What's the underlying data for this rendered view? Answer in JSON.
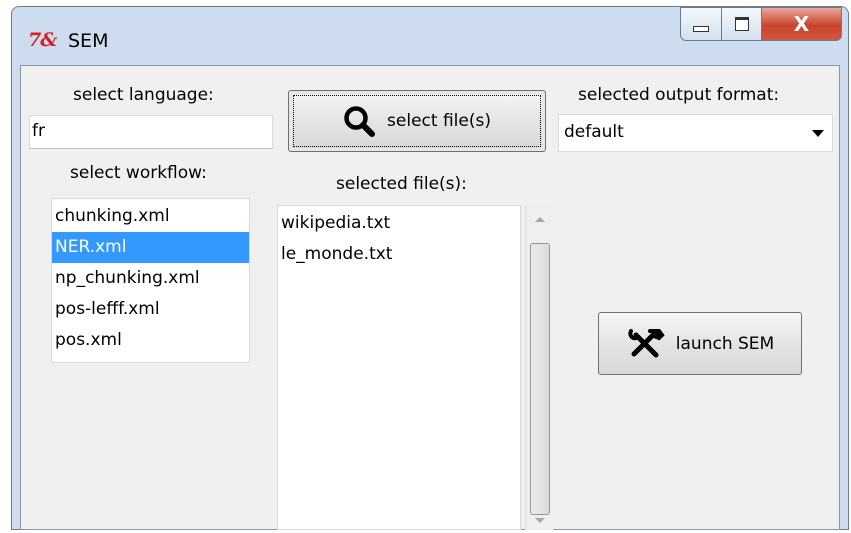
{
  "window": {
    "logo": "7&",
    "title": "SEM",
    "close_glyph": "X"
  },
  "language": {
    "label": "select language:",
    "value": "fr"
  },
  "select_file_button": {
    "icon": "search-icon",
    "label": "select file(s)"
  },
  "output_format": {
    "label": "selected output format:",
    "selected": "default"
  },
  "workflow": {
    "label": "select workflow:",
    "items": [
      "chunking.xml",
      "NER.xml",
      "np_chunking.xml",
      "pos-lefff.xml",
      "pos.xml"
    ],
    "selected_index": 1
  },
  "files": {
    "label": "selected file(s):",
    "items": [
      "wikipedia.txt",
      "le_monde.txt"
    ]
  },
  "launch_button": {
    "icon": "tools-icon",
    "label": "launch SEM"
  },
  "colors": {
    "selection": "#3399ff",
    "close_button": "#c8432d",
    "title_logo": "#d42020"
  }
}
